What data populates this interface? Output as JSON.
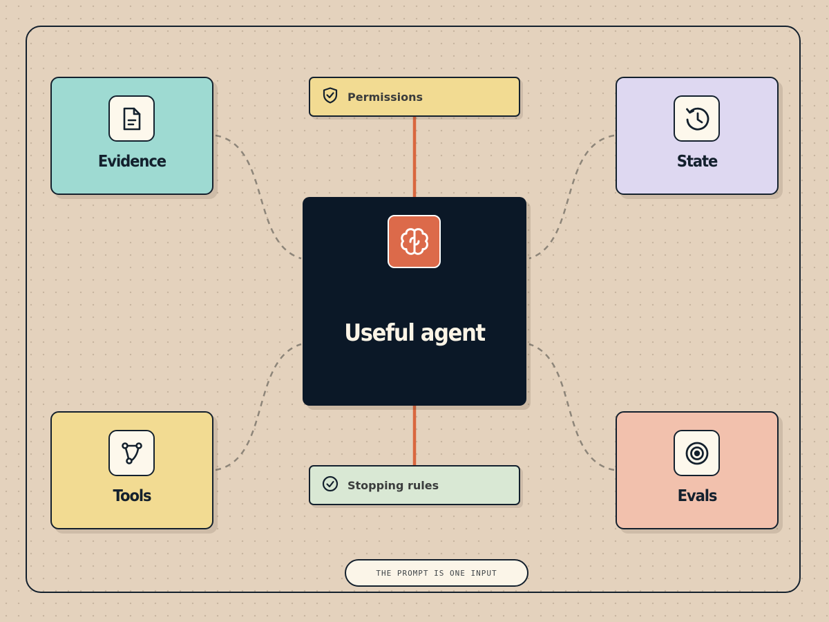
{
  "core": {
    "title": "Useful agent",
    "icon": "brain-icon",
    "color": "#0b1827",
    "icon_bg": "#dc6a4a"
  },
  "nodes": {
    "evidence": {
      "label": "Evidence",
      "icon": "document-icon",
      "color": "#9edad2"
    },
    "state": {
      "label": "State",
      "icon": "history-icon",
      "color": "#ded8f1"
    },
    "tools": {
      "label": "Tools",
      "icon": "route-icon",
      "color": "#f2db92"
    },
    "evals": {
      "label": "Evals",
      "icon": "target-icon",
      "color": "#f2c1ad"
    }
  },
  "constraints": {
    "permissions": {
      "label": "Permissions",
      "icon": "shield-check-icon",
      "color": "#f2db92"
    },
    "stopping": {
      "label": "Stopping rules",
      "icon": "check-circle-icon",
      "color": "#d9e8d4"
    }
  },
  "footer": {
    "note": "THE PROMPT IS ONE INPUT"
  },
  "colors": {
    "background": "#e4d2bd",
    "ink": "#13202d",
    "accent_line": "#d9673f",
    "dashed_line": "#8d8579"
  }
}
